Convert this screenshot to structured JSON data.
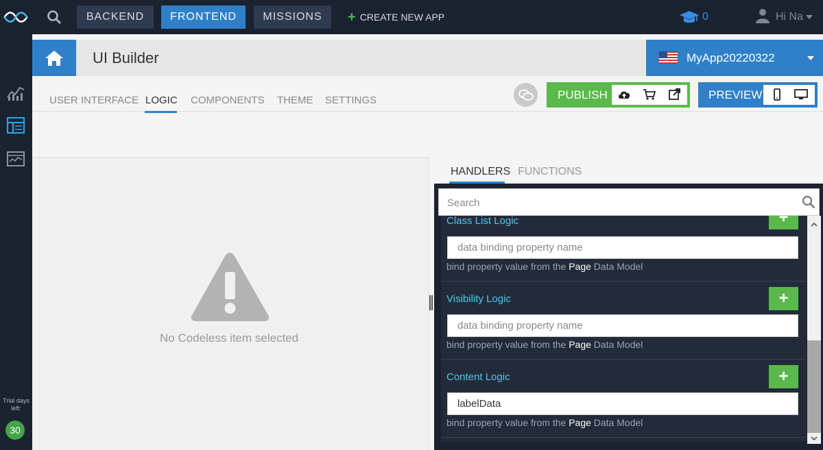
{
  "topnav": {
    "backend": "BACKEND",
    "frontend": "FRONTEND",
    "missions": "MISSIONS",
    "create_app": "CREATE NEW APP",
    "plus_icon": "+",
    "mission_count": "0",
    "greeting": "Hi Na"
  },
  "sidebar": {
    "trial_label": "Trial days left:",
    "trial_days": "30"
  },
  "header": {
    "title": "UI Builder",
    "app_name": "MyApp20220322"
  },
  "tabs": {
    "user_interface": "USER INTERFACE",
    "logic": "LOGIC",
    "components": "COMPONENTS",
    "theme": "THEME",
    "settings": "SETTINGS"
  },
  "actions": {
    "publish": "PUBLISH",
    "preview": "PREVIEW"
  },
  "left_pane": {
    "empty_message": "No Codeless item selected"
  },
  "right_tabs": {
    "handlers": "HANDLERS",
    "functions": "FUNCTIONS"
  },
  "search": {
    "placeholder": "Search"
  },
  "handlers": [
    {
      "title": "Class List Logic",
      "add_label": "+",
      "value": "",
      "placeholder": "data binding property name",
      "hint_prefix": "bind property value from the ",
      "hint_strong": "Page",
      "hint_suffix": " Data Model"
    },
    {
      "title": "Visibility Logic",
      "add_label": "+",
      "value": "",
      "placeholder": "data binding property name",
      "hint_prefix": "bind property value from the ",
      "hint_strong": "Page",
      "hint_suffix": " Data Model"
    },
    {
      "title": "Content Logic",
      "add_label": "+",
      "value": "labelData",
      "placeholder": "data binding property name",
      "hint_prefix": "bind property value from the ",
      "hint_strong": "Page",
      "hint_suffix": " Data Model"
    }
  ],
  "colors": {
    "dark_bg": "#1b2230",
    "accent_blue": "#2f80c8",
    "accent_green": "#5ab94a",
    "handler_title": "#4ec9e6"
  }
}
